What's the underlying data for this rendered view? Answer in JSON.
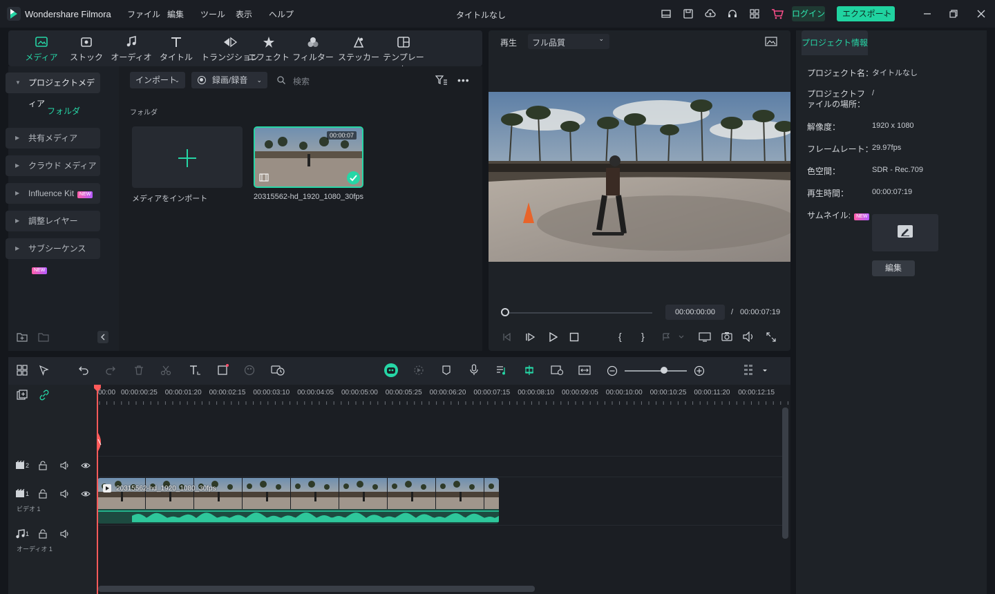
{
  "app": {
    "name": "Wondershare Filmora",
    "document_title": "タイトルなし",
    "menu": [
      "ファイル",
      "編集",
      "ツール",
      "表示",
      "ヘルプ"
    ],
    "login_label": "ログイン",
    "export_label": "エクスポート"
  },
  "media_tabs": [
    {
      "label": "メディア",
      "icon": "media-icon",
      "active": true
    },
    {
      "label": "ストック",
      "icon": "stock-icon"
    },
    {
      "label": "オーディオ",
      "icon": "music-icon"
    },
    {
      "label": "タイトル",
      "icon": "title-icon"
    },
    {
      "label": "トランジション",
      "icon": "transition-icon"
    },
    {
      "label": "エフェクト",
      "icon": "effect-icon"
    },
    {
      "label": "フィルター",
      "icon": "filter-icon"
    },
    {
      "label": "ステッカー",
      "icon": "sticker-icon"
    },
    {
      "label": "テンプレート",
      "icon": "template-icon"
    }
  ],
  "left_nav": {
    "project_media": "プロジェクトメディア",
    "folder": "フォルダ",
    "items": [
      {
        "label": "共有メディア",
        "new": false
      },
      {
        "label": "クラウド メディア",
        "new": false
      },
      {
        "label": "Influence Kit",
        "new": true
      },
      {
        "label": "調整レイヤー",
        "new": false
      },
      {
        "label": "サブシーケンス",
        "new": true
      }
    ],
    "new_badge": "NEW"
  },
  "media_area": {
    "import_label": "インポート",
    "record_label": "録画/録音",
    "search_placeholder": "検索",
    "folder_header": "フォルダ",
    "import_media_label": "メディアをインポート",
    "clip_name": "20315562-hd_1920_1080_30fps",
    "clip_duration": "00:00:07"
  },
  "preview": {
    "play_label": "再生",
    "quality": "フル品質",
    "current_time": "00:00:00:00",
    "separator": "/",
    "total_time": "00:00:07:19"
  },
  "project_info": {
    "tab": "プロジェクト情報",
    "rows": [
      {
        "label": "プロジェクト名：",
        "value": "タイトルなし"
      },
      {
        "label": "プロジェクトファイルの場所：",
        "value": "/"
      },
      {
        "label": "解像度：",
        "value": "1920 x 1080"
      },
      {
        "label": "フレームレート：",
        "value": "29.97fps"
      },
      {
        "label": "色空間：",
        "value": "SDR - Rec.709"
      },
      {
        "label": "再生時間：",
        "value": "00:00:07:19"
      }
    ],
    "thumbnail_label": "サムネイル:",
    "edit_label": "編集"
  },
  "timeline": {
    "ruler": [
      "00:00",
      "00:00:00:25",
      "00:00:01:20",
      "00:00:02:15",
      "00:00:03:10",
      "00:00:04:05",
      "00:00:05:00",
      "00:00:05:25",
      "00:00:06:20",
      "00:00:07:15",
      "00:00:08:10",
      "00:00:09:05",
      "00:00:10:00",
      "00:00:10:25",
      "00:00:11:20",
      "00:00:12:15"
    ],
    "video_track_label": "ビデオ 1",
    "audio_track_label": "オーディオ 1",
    "clip_title": "20315562-hd_1920_1080_30fps",
    "track2_num": "2",
    "track1_num": "1",
    "audio_num": "1"
  },
  "colors": {
    "accent": "#26d6a6",
    "playhead": "#ff5a5a",
    "background": "#14171c"
  }
}
